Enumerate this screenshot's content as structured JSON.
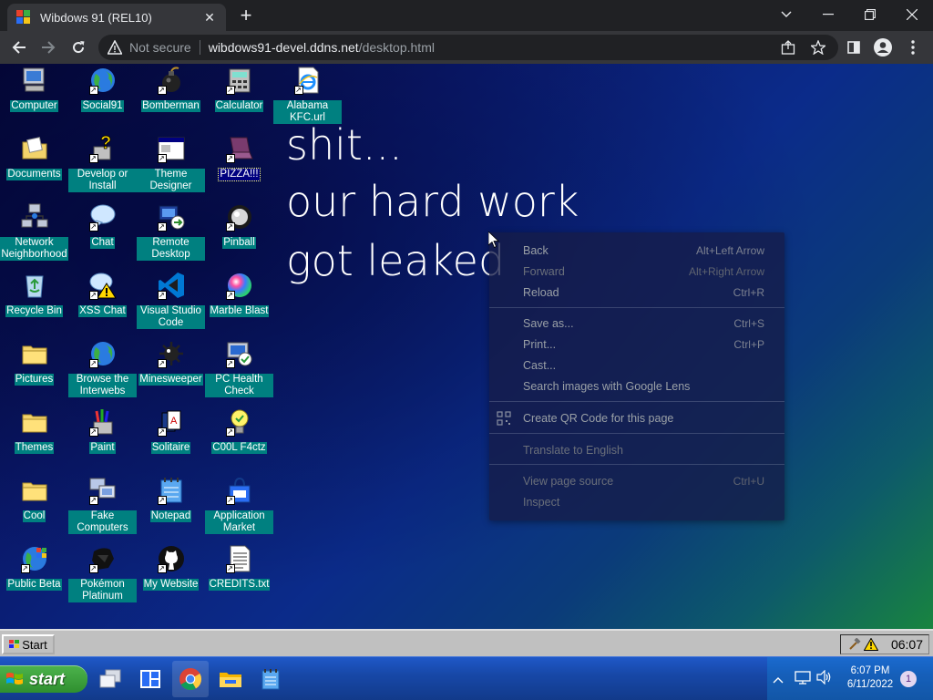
{
  "browser": {
    "tab_title": "Wibdows 91 (REL10)",
    "tab_close": "✕",
    "new_tab": "+",
    "not_secure": "Not secure",
    "url_host": "wibdows91-devel.ddns.net",
    "url_path": "/desktop.html"
  },
  "desktop": {
    "icons": [
      {
        "label": "Computer"
      },
      {
        "label": "Social91"
      },
      {
        "label": "Bomberman"
      },
      {
        "label": "Calculator"
      },
      {
        "label": "Alabama KFC.url"
      },
      {
        "label": "Documents"
      },
      {
        "label": "Develop or Install"
      },
      {
        "label": "Theme Designer"
      },
      {
        "label": "PIZZA!!!"
      },
      {
        "label": "Network Neighborhood"
      },
      {
        "label": "Chat"
      },
      {
        "label": "Remote Desktop"
      },
      {
        "label": "Pinball"
      },
      {
        "label": "Recycle Bin"
      },
      {
        "label": "XSS Chat"
      },
      {
        "label": "Visual Studio Code"
      },
      {
        "label": "Marble Blast"
      },
      {
        "label": "Pictures"
      },
      {
        "label": "Browse the Interwebs"
      },
      {
        "label": "Minesweeper"
      },
      {
        "label": "PC Health Check"
      },
      {
        "label": "Themes"
      },
      {
        "label": "Paint"
      },
      {
        "label": "Solitaire"
      },
      {
        "label": "C00L F4ctz"
      },
      {
        "label": "Cool"
      },
      {
        "label": "Fake Computers"
      },
      {
        "label": "Notepad"
      },
      {
        "label": "Application Market"
      },
      {
        "label": "Public Beta"
      },
      {
        "label": "Pokémon Platinum"
      },
      {
        "label": "My Website"
      },
      {
        "label": "CREDITS.txt"
      }
    ],
    "leak_lines": [
      "shit...",
      "our hard work",
      "got leaked"
    ]
  },
  "context_menu": {
    "back": {
      "label": "Back",
      "shortcut": "Alt+Left Arrow"
    },
    "forward": {
      "label": "Forward",
      "shortcut": "Alt+Right Arrow"
    },
    "reload": {
      "label": "Reload",
      "shortcut": "Ctrl+R"
    },
    "save_as": {
      "label": "Save as...",
      "shortcut": "Ctrl+S"
    },
    "print": {
      "label": "Print...",
      "shortcut": "Ctrl+P"
    },
    "cast": {
      "label": "Cast..."
    },
    "lens": {
      "label": "Search images with Google Lens"
    },
    "qr": {
      "label": "Create QR Code for this page"
    },
    "translate": {
      "label": "Translate to English"
    },
    "view_source": {
      "label": "View page source",
      "shortcut": "Ctrl+U"
    },
    "inspect": {
      "label": "Inspect"
    }
  },
  "w9_taskbar": {
    "start_label": "Start",
    "clock": "06:07"
  },
  "w7_taskbar": {
    "start_label": "start",
    "time": "6:07 PM",
    "date": "6/11/2022",
    "notification_count": "1"
  }
}
